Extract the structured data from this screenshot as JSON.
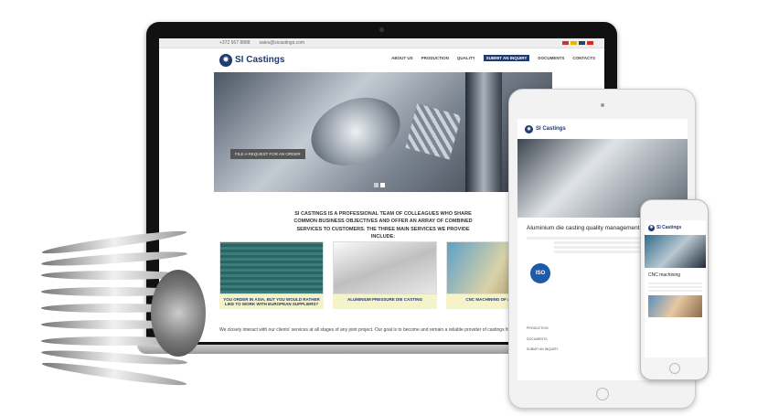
{
  "site": {
    "phone": "+372 567 8888",
    "email": "sales@sicastings.com",
    "logo_text": "SI Castings",
    "nav": [
      "ABOUT US",
      "PRODUCTION",
      "QUALITY",
      "SUBMIT AN INQUIRY",
      "DOCUMENTS",
      "CONTACTS"
    ],
    "hero_button": "FILE A REQUEST FOR AN ORDER",
    "intro": "SI CASTINGS IS A PROFESSIONAL TEAM OF COLLEAGUES WHO SHARE COMMON BUSINESS OBJECTIVES AND OFFER AN ARRAY OF COMBINED SERVICES TO CUSTOMERS. THE THREE MAIN SERVICES WE PROVIDE INCLUDE:",
    "cards": [
      {
        "caption": "YOU ORDER IN ASIA, BUT YOU WOULD RATHER LIKE TO WORK WITH EUROPEAN SUPPLIERS?"
      },
      {
        "caption": "ALUMINIUM PRESSURE DIE CASTING"
      },
      {
        "caption": "CNC MACHINING OF ALUMINIUM"
      }
    ],
    "footer_text": "We closely interact with our clients' services at all stages of any joint project. Our goal is to become and remain a reliable provider of castings for our"
  },
  "tablet": {
    "title": "Aluminium die casting quality management system",
    "iso": "ISO",
    "links": [
      "PRODUCTION",
      "DOCUMENTS",
      "SUBMIT AN INQUIRY"
    ]
  },
  "phone_view": {
    "title": "CNC machining"
  },
  "colors": {
    "brand": "#1e3a72",
    "caption_bg": "#f7f3c9"
  }
}
